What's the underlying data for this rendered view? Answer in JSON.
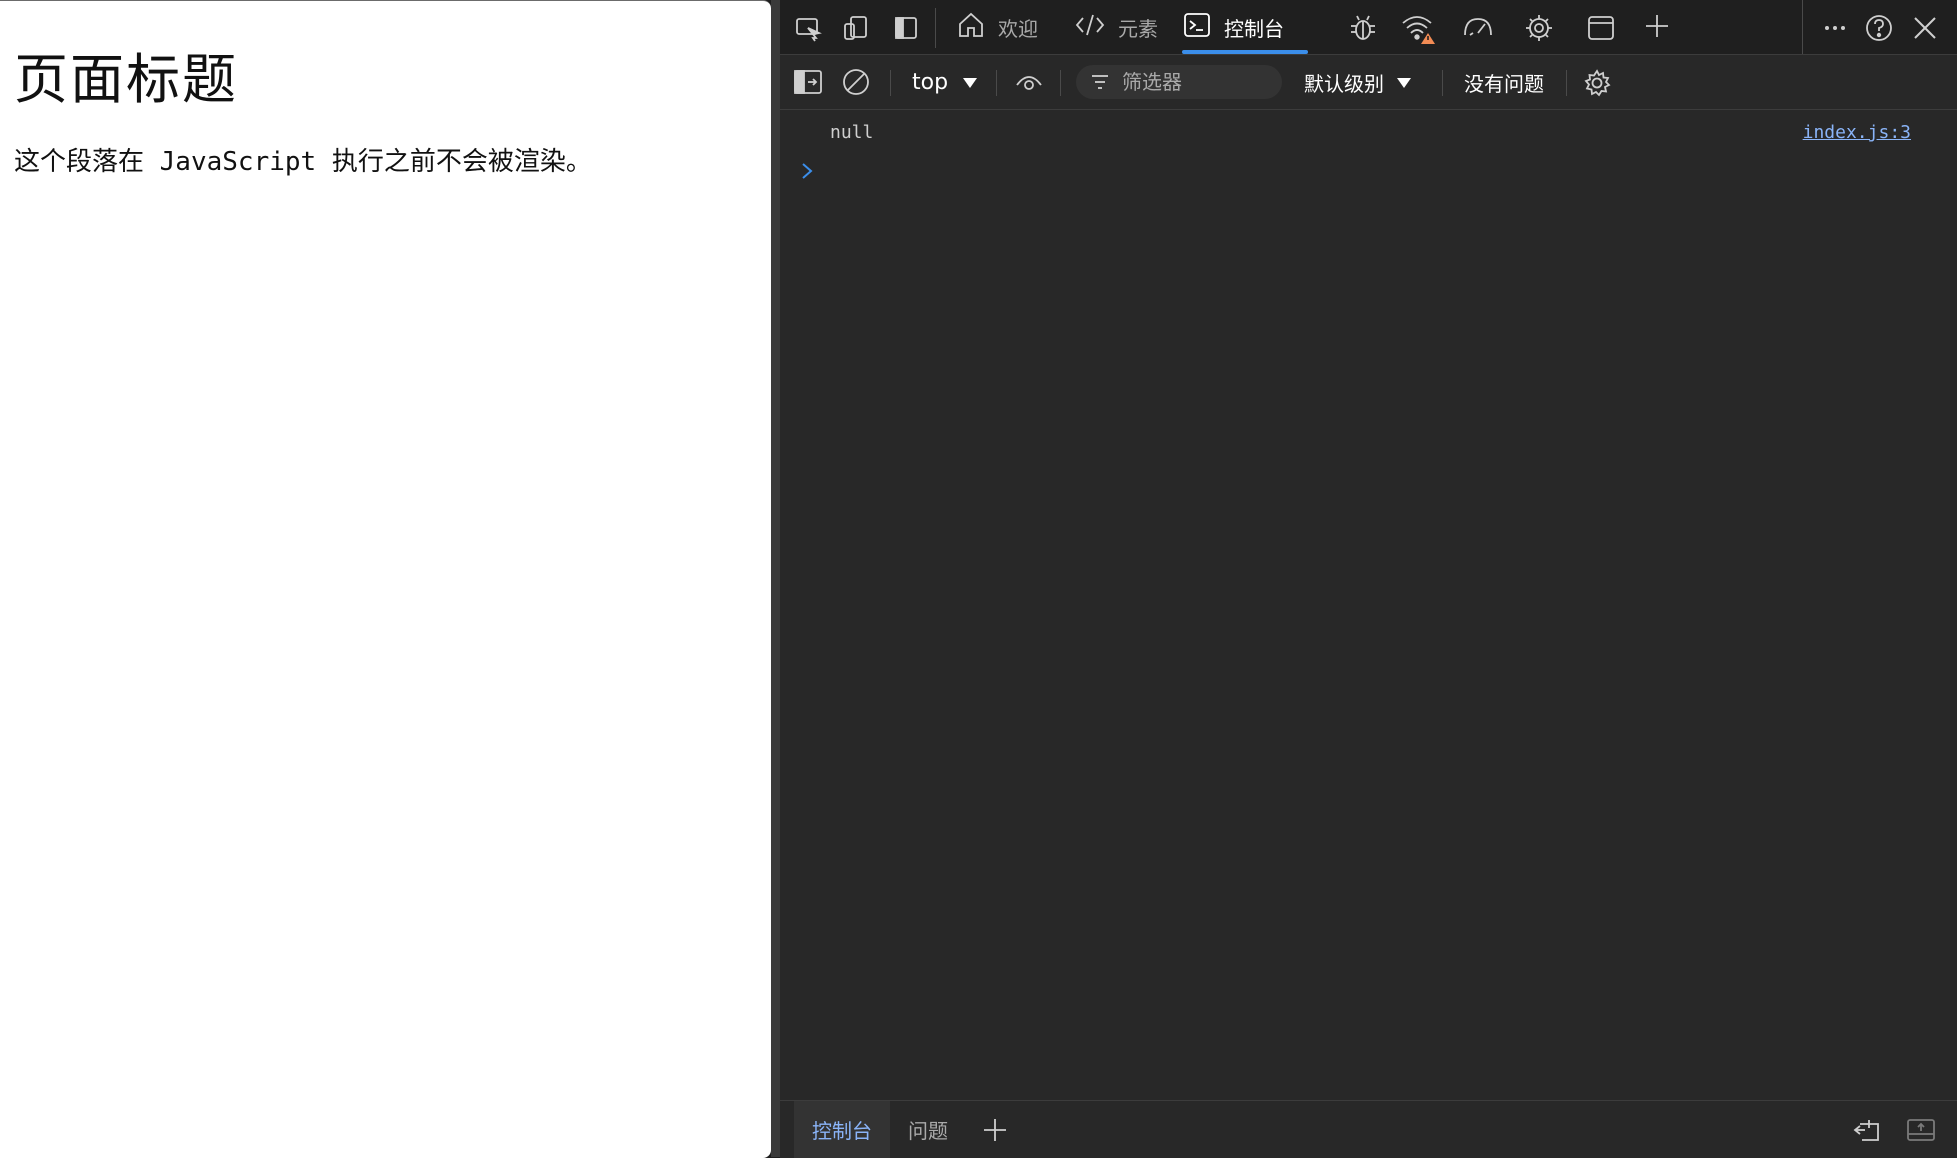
{
  "page": {
    "heading": "页面标题",
    "paragraph": "这个段落在 JavaScript 执行之前不会被渲染。"
  },
  "devtools": {
    "tabs": [
      {
        "label": "欢迎",
        "icon": "home-icon"
      },
      {
        "label": "元素",
        "icon": "code-icon"
      },
      {
        "label": "控制台",
        "icon": "console-icon",
        "active": true
      }
    ],
    "toolbar": {
      "context": "top",
      "filter_placeholder": "筛选器",
      "level": "默认级别",
      "issues": "没有问题"
    },
    "console": {
      "output": "null",
      "source": "index.js:3"
    },
    "drawer": {
      "tabs": [
        "控制台",
        "问题"
      ]
    },
    "colors": {
      "accent": "#3b8eea",
      "link": "#8ab4f8",
      "warning": "#f28b54"
    }
  }
}
